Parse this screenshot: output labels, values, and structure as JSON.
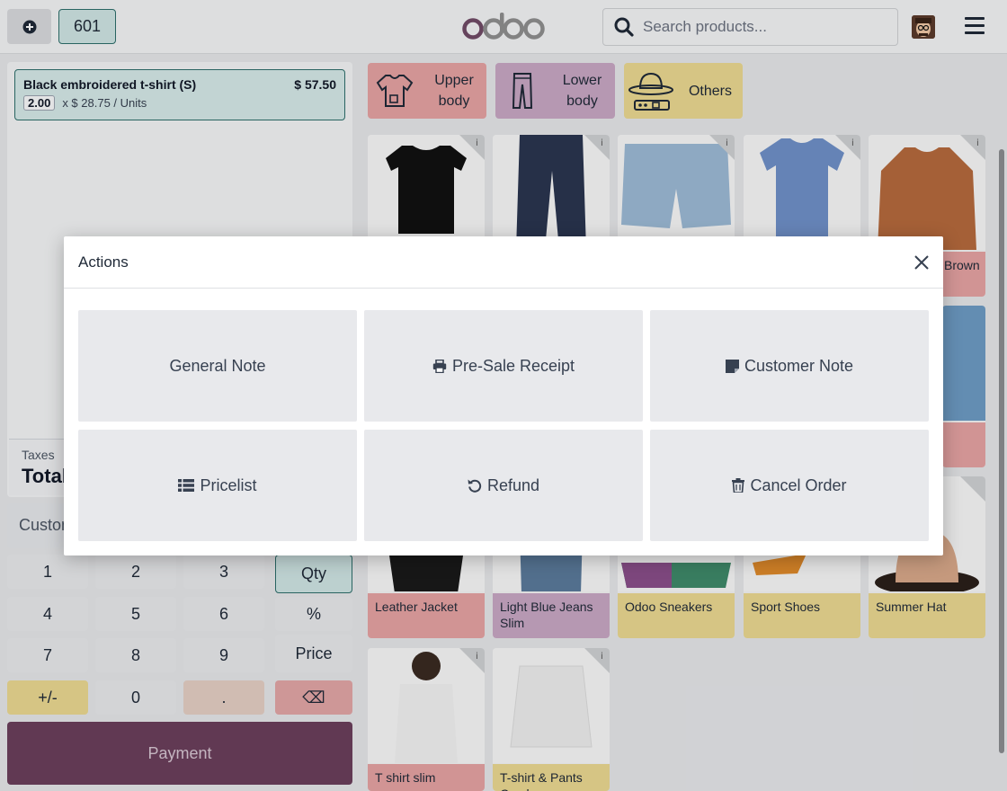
{
  "topbar": {
    "order_number": "601",
    "logo_text": "odoo",
    "search_placeholder": "Search products..."
  },
  "order": {
    "line": {
      "name": "Black embroidered t-shirt (S)",
      "price": "$ 57.50",
      "qty": "2.00",
      "unit_price": "x $ 28.75 / Units"
    },
    "taxes_label": "Taxes",
    "total_label": "Total",
    "customer_label": "Customer"
  },
  "numpad": {
    "keys": [
      "1",
      "2",
      "3",
      "Qty",
      "4",
      "5",
      "6",
      "%",
      "7",
      "8",
      "9",
      "Price",
      "+/-",
      "0",
      ".",
      "⌫"
    ],
    "payment_label": "Payment"
  },
  "categories": [
    {
      "label": "Upper body",
      "icon": "tshirt-icon",
      "color": "#e6a3a3"
    },
    {
      "label": "Lower body",
      "icon": "pants-icon",
      "color": "#c9a8c4"
    },
    {
      "label": "Others",
      "icon": "hat-icon",
      "color": "#ecd992"
    }
  ],
  "products": [
    {
      "name": "Leather Jacket"
    },
    {
      "name": "Light Blue Jeans Slim"
    },
    {
      "name": "Odoo Sneakers"
    },
    {
      "name": "Sport Shoes"
    },
    {
      "name": "Summer Hat"
    },
    {
      "name": "T shirt slim"
    },
    {
      "name": "T-shirt & Pants Combo"
    },
    {
      "name": "Brown"
    }
  ],
  "modal": {
    "title": "Actions",
    "buttons": {
      "general_note": "General Note",
      "pre_sale_receipt": "Pre-Sale Receipt",
      "customer_note": "Customer Note",
      "pricelist": "Pricelist",
      "refund": "Refund",
      "cancel_order": "Cancel Order"
    }
  },
  "colors": {
    "accent_teal": "#2e6e6b",
    "payment": "#6b3f5c",
    "red_category": "#e6a3a3",
    "purple_category": "#c9a8c4",
    "yellow_category": "#ecd992"
  }
}
